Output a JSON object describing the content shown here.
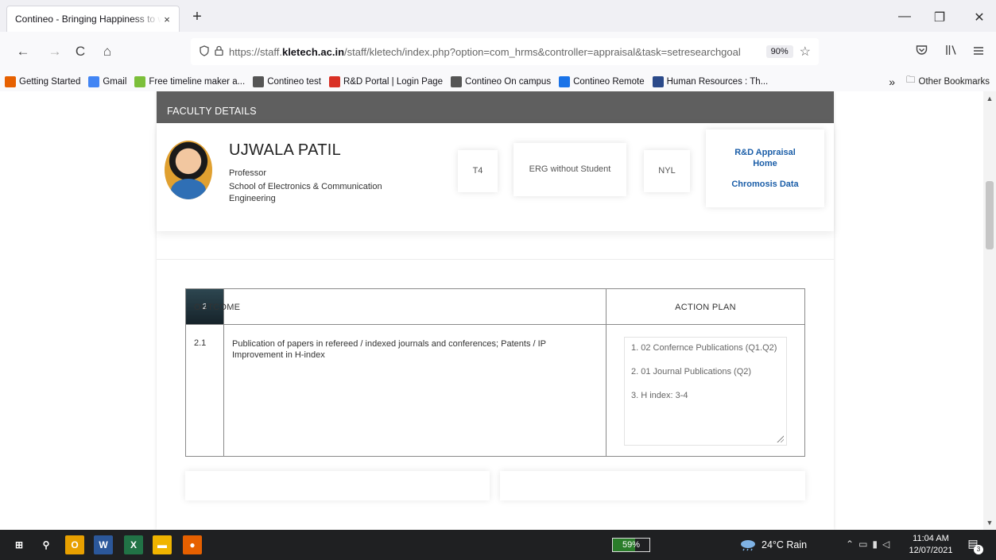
{
  "browser": {
    "tab": {
      "title": "Contineo - Bringing Happiness to w",
      "close": "×"
    },
    "new_tab": "+",
    "window": {
      "minimize": "—",
      "restore": "❐",
      "close": "✕"
    },
    "nav": {
      "back": "←",
      "forward": "→",
      "reload": "C",
      "home": "⌂"
    },
    "url": {
      "prefix": "https://staff.",
      "domain": "kletech.ac.in",
      "suffix": "/staff/kletech/index.php?option=com_hrms&controller=appraisal&task=setresearchgoal",
      "zoom": "90%",
      "star": "☆"
    },
    "toolbar_icons": [
      "pocket-icon",
      "library-icon",
      "menu-icon"
    ],
    "bookmarks": [
      {
        "label": "Getting Started",
        "icon": "firefox-icon",
        "color": "#e66000"
      },
      {
        "label": "Gmail",
        "icon": "google-icon",
        "color": "#4285f4"
      },
      {
        "label": "Free timeline maker a...",
        "icon": "timeline-icon",
        "color": "#7cbf3a"
      },
      {
        "label": "Contineo test",
        "icon": "globe-icon",
        "color": "#555555"
      },
      {
        "label": "R&D Portal | Login Page",
        "icon": "rd-portal-icon",
        "color": "#d93025"
      },
      {
        "label": "Contineo On campus",
        "icon": "globe-icon",
        "color": "#555555"
      },
      {
        "label": "Contineo Remote",
        "icon": "contineo-s-icon",
        "color": "#1a73e8"
      },
      {
        "label": "Human Resources : Th...",
        "icon": "crest-icon",
        "color": "#2b4a8a"
      }
    ],
    "bookmarks_overflow": "»",
    "other_bookmarks": "Other Bookmarks"
  },
  "page": {
    "section_header": "FACULTY DETAILS",
    "faculty": {
      "name": "UJWALA PATIL",
      "designation": "Professor",
      "school": "School of Electronics & Communication Engineering"
    },
    "chips": [
      "T4",
      "ERG without Student",
      "NYL"
    ],
    "links": {
      "appraisal_home": "R&D Appraisal Home",
      "chromosis": "Chromosis Data"
    },
    "table": {
      "section_number": "2",
      "outcome_header": "OUTCOME",
      "action_plan_header": "ACTION PLAN",
      "rows": [
        {
          "number": "2.1",
          "outcome": "Publication of papers in refereed / indexed journals and conferences; Patents / IP Improvement in H-index",
          "action_plan": [
            "1. 02 Confernce Publications (Q1.Q2)",
            "2. 01 Journal Publications  (Q2)",
            "3. H index: 3-4"
          ]
        }
      ]
    }
  },
  "taskbar": {
    "apps": [
      {
        "name": "start-icon",
        "glyph": "⊞",
        "color": "#1f2022"
      },
      {
        "name": "search-icon",
        "glyph": "⚲",
        "color": "#1f2022"
      },
      {
        "name": "outlook-icon",
        "glyph": "O",
        "color": "#e8a000"
      },
      {
        "name": "word-icon",
        "glyph": "W",
        "color": "#2b579a"
      },
      {
        "name": "excel-icon",
        "glyph": "X",
        "color": "#217346"
      },
      {
        "name": "file-explorer-icon",
        "glyph": "▬",
        "color": "#f0b400"
      },
      {
        "name": "firefox-icon",
        "glyph": "●",
        "color": "#e66000"
      }
    ],
    "battery": "59%",
    "weather": "24°C  Rain",
    "time": "11:04 AM",
    "date": "12/07/2021",
    "notifications": "3"
  }
}
